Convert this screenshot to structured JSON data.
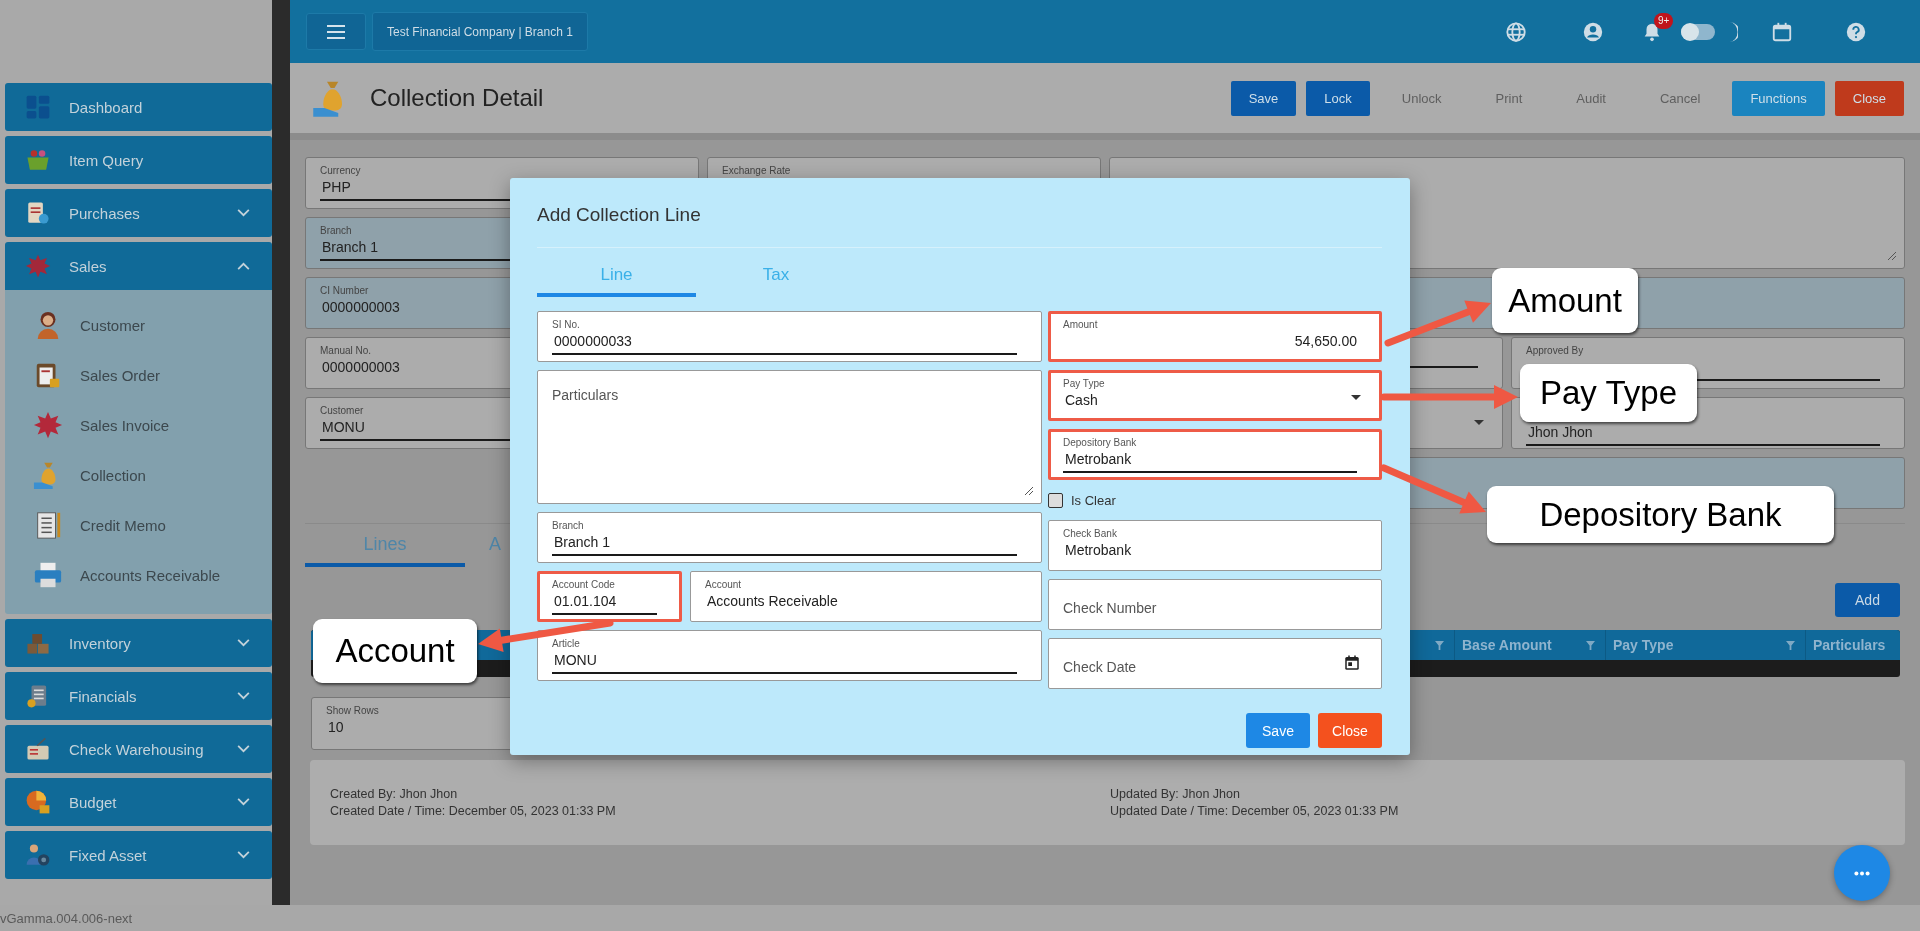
{
  "top_bar": {
    "company": "Test Financial Company | Branch 1",
    "notification_count": "9+",
    "dark_mode": false
  },
  "sidebar": {
    "items": [
      {
        "label": "Dashboard"
      },
      {
        "label": "Item Query"
      },
      {
        "label": "Purchases",
        "expanded": false
      },
      {
        "label": "Sales",
        "expanded": true,
        "children": [
          {
            "label": "Customer"
          },
          {
            "label": "Sales Order"
          },
          {
            "label": "Sales Invoice"
          },
          {
            "label": "Collection"
          },
          {
            "label": "Credit Memo"
          },
          {
            "label": "Accounts Receivable"
          }
        ]
      },
      {
        "label": "Inventory",
        "expanded": false
      },
      {
        "label": "Financials",
        "expanded": false
      },
      {
        "label": "Check Warehousing",
        "expanded": false
      },
      {
        "label": "Budget",
        "expanded": false
      },
      {
        "label": "Fixed Asset",
        "expanded": false
      }
    ],
    "version": "vGamma.004.006-next"
  },
  "page": {
    "title": "Collection Detail",
    "actions": [
      {
        "label": "Save",
        "kind": "primary",
        "disabled": false
      },
      {
        "label": "Lock",
        "kind": "primary",
        "disabled": false
      },
      {
        "label": "Unlock",
        "kind": "primary",
        "disabled": true
      },
      {
        "label": "Print",
        "kind": "primary",
        "disabled": true
      },
      {
        "label": "Audit",
        "kind": "primary",
        "disabled": true
      },
      {
        "label": "Cancel",
        "kind": "primary",
        "disabled": true
      },
      {
        "label": "Functions",
        "kind": "info",
        "disabled": false
      },
      {
        "label": "Close",
        "kind": "danger",
        "disabled": false
      }
    ]
  },
  "details": {
    "fields": [
      {
        "kind": "text",
        "label": "Currency",
        "value": "PHP",
        "disabled": false,
        "editable": true
      },
      {
        "kind": "text",
        "label": "Exchange Rate",
        "disabled": false,
        "editable": false
      },
      {
        "kind": "textarea",
        "disabled": false
      },
      {
        "kind": "text",
        "label": "Branch",
        "value": "Branch 1",
        "disabled": true,
        "editable": true
      },
      {
        "kind": "text",
        "label": "CI Number",
        "value": "0000000003",
        "disabled": true,
        "editable": false
      },
      {
        "kind": "text",
        "disabled": true,
        "editable": false
      },
      {
        "kind": "text",
        "label": "Manual No.",
        "value": "0000000003",
        "disabled": false,
        "editable": false
      },
      {
        "kind": "text",
        "disabled": false,
        "editable": true
      },
      {
        "kind": "text",
        "label": "Approved By",
        "disabled": false,
        "editable": true
      },
      {
        "kind": "text",
        "label": "Customer",
        "value": "MONU",
        "disabled": false,
        "editable": true
      },
      {
        "kind": "select",
        "disabled": false
      },
      {
        "kind": "text",
        "value": "Jhon Jhon",
        "disabled": false,
        "editable": true
      },
      {
        "kind": "text",
        "disabled": true,
        "editable": false
      }
    ]
  },
  "lines": {
    "tabs": [
      {
        "label": "Lines",
        "selected": true
      },
      {
        "label": "A",
        "selected": false
      }
    ],
    "add_button": "Add",
    "columns": [
      "Base Amount",
      "Pay Type",
      "Particulars"
    ],
    "show_rows": {
      "label": "Show Rows",
      "value": "10"
    }
  },
  "audit": {
    "created_by": "Created By: Jhon Jhon",
    "created_at": "Created Date / Time: December 05, 2023 01:33 PM",
    "updated_by": "Updated By: Jhon Jhon",
    "updated_at": "Updated Date / Time: December 05, 2023 01:33 PM"
  },
  "dialog": {
    "title": "Add Collection Line",
    "tabs": [
      {
        "label": "Line",
        "selected": true
      },
      {
        "label": "Tax",
        "selected": false
      }
    ],
    "left_rows": [
      [
        {
          "kind": "text",
          "label": "SI No.",
          "value": "0000000033",
          "editable": true,
          "highlighted": false
        }
      ],
      [
        {
          "kind": "textarea",
          "placeholder": "Particulars",
          "highlighted": false
        }
      ],
      [
        {
          "kind": "text",
          "label": "Branch",
          "value": "Branch 1",
          "editable": true,
          "highlighted": false
        }
      ],
      [
        {
          "kind": "text",
          "label": "Account Code",
          "value": "01.01.104",
          "editable": true,
          "highlighted": true
        },
        {
          "kind": "text",
          "label": "Account",
          "value": "Accounts Receivable",
          "editable": false,
          "highlighted": false
        }
      ],
      [
        {
          "kind": "text",
          "label": "Article",
          "value": "MONU",
          "editable": true,
          "highlighted": false
        }
      ]
    ],
    "right_fields": [
      {
        "kind": "number",
        "label": "Amount",
        "value": "54,650.00",
        "editable": false,
        "highlighted": true
      },
      {
        "kind": "select",
        "label": "Pay Type",
        "value": "Cash",
        "highlighted": true
      },
      {
        "kind": "text",
        "label": "Depository Bank",
        "value": "Metrobank",
        "editable": true,
        "highlighted": true
      },
      {
        "kind": "checkbox",
        "label": "Is Clear",
        "checked": false
      },
      {
        "kind": "text",
        "label": "Check Bank",
        "value": "Metrobank",
        "editable": false,
        "highlighted": false
      },
      {
        "kind": "text",
        "placeholder": "Check Number",
        "highlighted": false
      },
      {
        "kind": "date",
        "placeholder": "Check Date",
        "highlighted": false
      }
    ],
    "buttons": [
      {
        "label": "Save",
        "kind": "primary"
      },
      {
        "label": "Close",
        "kind": "danger"
      }
    ]
  },
  "callouts": [
    {
      "label": "Amount"
    },
    {
      "label": "Pay Type"
    },
    {
      "label": "Depository Bank"
    },
    {
      "label": "Account"
    }
  ]
}
